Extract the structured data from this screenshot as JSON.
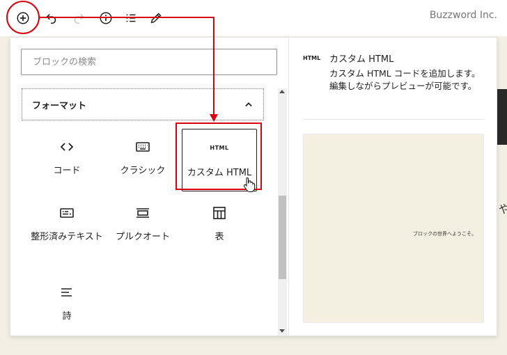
{
  "toolbar": {
    "brand": "Buzzword Inc."
  },
  "search": {
    "placeholder": "ブロックの検索"
  },
  "category": {
    "label": "フォーマット"
  },
  "blocks": [
    {
      "label": "コード",
      "icon": "code-icon"
    },
    {
      "label": "クラシック",
      "icon": "keyboard-icon"
    },
    {
      "label": "カスタム HTML",
      "icon": "html-icon",
      "tag": "HTML"
    },
    {
      "label": "整形済みテキスト",
      "icon": "preformatted-icon"
    },
    {
      "label": "プルクオート",
      "icon": "pullquote-icon"
    },
    {
      "label": "表",
      "icon": "table-icon"
    },
    {
      "label": "詩",
      "icon": "verse-icon"
    }
  ],
  "preview_panel": {
    "tag": "HTML",
    "title": "カスタム HTML",
    "description": "カスタム HTML コードを追加します。編集しながらプレビューが可能です。",
    "preview_text": "ブロックの世界へようこそ。"
  },
  "background": {
    "peek_text": "や"
  },
  "colors": {
    "annotation": "#d9000d",
    "preview_bg": "#f3efe1",
    "page_bg": "#f3efe4"
  }
}
